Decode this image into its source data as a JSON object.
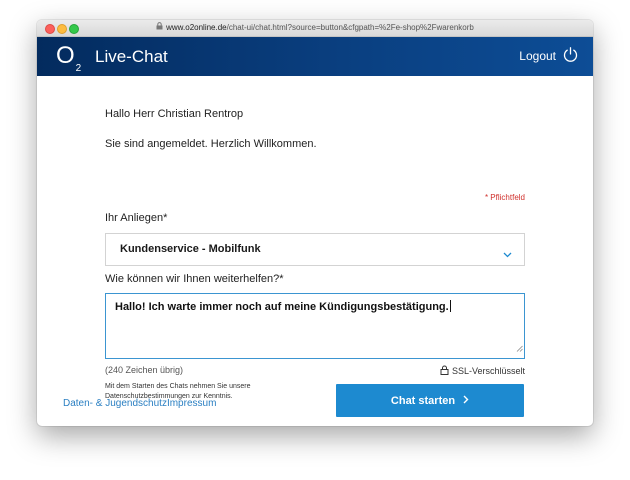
{
  "browser": {
    "url_host": "www.o2online.de",
    "url_path": "/chat-ui/chat.html?source=button&cfgpath=%2Fe-shop%2Fwarenkorb"
  },
  "header": {
    "logo_text": "O",
    "logo_sub": "2",
    "title": "Live-Chat",
    "logout_label": "Logout",
    "background_color": "#0a3f80"
  },
  "main": {
    "greeting": "Hallo Herr Christian Rentrop",
    "welcome": "Sie sind angemeldet. Herzlich Willkommen.",
    "required_note": "* Pflichtfeld",
    "concern_label": "Ihr Anliegen*",
    "concern_value": "Kundenservice - Mobilfunk",
    "help_label": "Wie können wir Ihnen weiterhelfen?*",
    "message_value": "Hallo! Ich warte immer noch auf meine Kündigungsbestätigung.",
    "chars_left": "(240 Zeichen übrig)",
    "ssl_label": "SSL-Verschlüsselt",
    "privacy_note": "Mit dem Starten des Chats nehmen Sie unsere Datenschutzbestimmungen zur Kenntnis.",
    "start_button": "Chat starten",
    "accent_color": "#1d8ad0"
  },
  "footer": {
    "link_privacy": "Daten- & Jugendschutz",
    "link_imprint": "Impressum"
  },
  "icons": [
    "lock-icon",
    "power-icon",
    "chevron-down-icon",
    "chevron-right-icon",
    "resize-handle-icon"
  ]
}
